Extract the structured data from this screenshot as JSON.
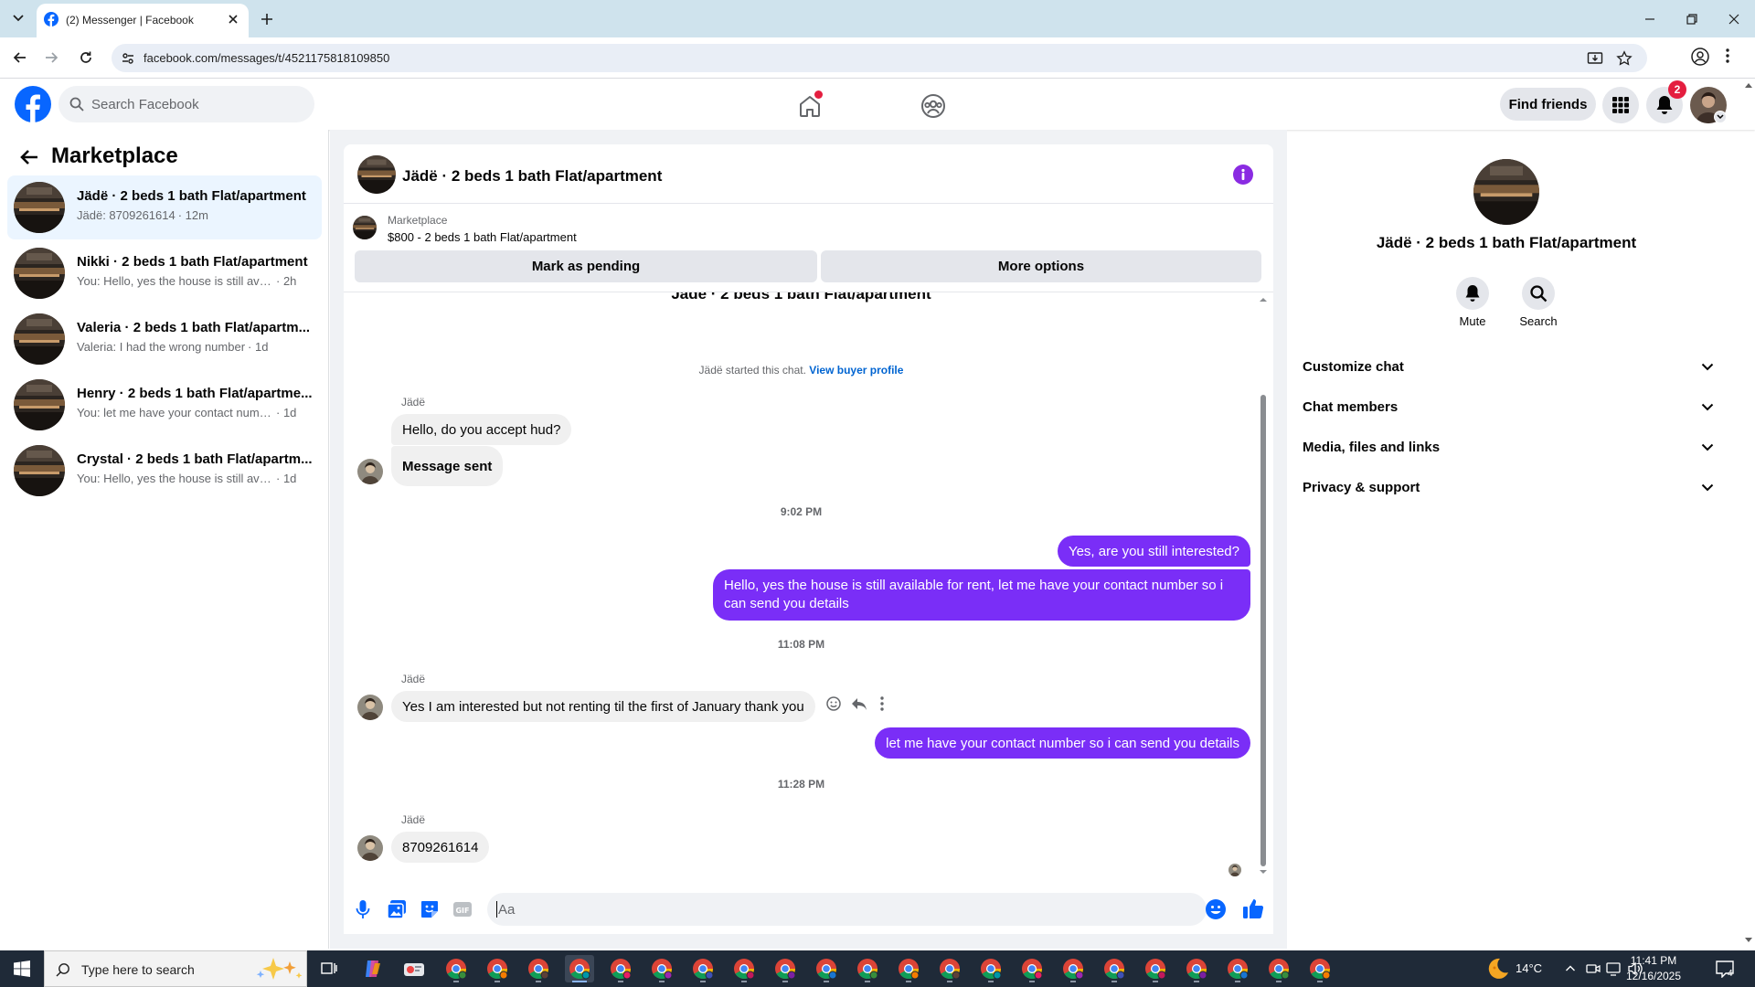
{
  "browser": {
    "tab_title": "(2) Messenger | Facebook",
    "url": "facebook.com/messages/t/4521175818109850"
  },
  "header": {
    "search_placeholder": "Search Facebook",
    "find_friends": "Find friends",
    "notification_count": "2"
  },
  "sidebar": {
    "title": "Marketplace",
    "conversations": [
      {
        "name": "Jädë · 2 beds 1 bath Flat/apartment",
        "preview": "Jädë: 8709261614",
        "time": " · 12m",
        "selected": true
      },
      {
        "name": "Nikki · 2 beds 1 bath Flat/apartment",
        "preview": "You: Hello, yes the house is still availa...",
        "time": " · 2h"
      },
      {
        "name": "Valeria · 2 beds 1 bath Flat/apartm...",
        "preview": "Valeria: I had the wrong number",
        "time": " · 1d"
      },
      {
        "name": "Henry · 2 beds 1 bath Flat/apartme...",
        "preview": "You: let me have your contact number...",
        "time": " · 1d"
      },
      {
        "name": "Crystal · 2 beds 1 bath Flat/apartm...",
        "preview": "You: Hello, yes the house is still availa...",
        "time": " · 1d"
      }
    ]
  },
  "chat": {
    "title": "Jädë · 2 beds 1 bath Flat/apartment",
    "listing_label": "Marketplace",
    "listing_price": "$800 - 2 beds 1 bath Flat/apartment",
    "mark_pending": "Mark as pending",
    "more_options": "More options",
    "partial_title": "Jädë · 2 beds 1 bath Flat/apartment",
    "started_text": "Jädë started this chat.",
    "view_profile": "View buyer profile",
    "sender_name": "Jädë",
    "messages": {
      "m1": "Hello, do you accept hud?",
      "m2": "Message sent",
      "ts1": "9:02 PM",
      "o1": "Yes, are you still interested?",
      "o2": "Hello, yes the house is still available for rent, let me have your contact number so i can send you details",
      "ts2": "11:08 PM",
      "m3": "Yes I am interested but not renting til the first of January thank you",
      "o3": "let me have your contact number so i can send you details",
      "ts3": "11:28 PM",
      "m4": "8709261614"
    },
    "input_placeholder": "Aa"
  },
  "details": {
    "name": "Jädë · 2 beds 1 bath Flat/apartment",
    "mute": "Mute",
    "search": "Search",
    "sections": [
      "Customize chat",
      "Chat members",
      "Media, files and links",
      "Privacy & support"
    ]
  },
  "taskbar": {
    "search_placeholder": "Type here to search",
    "temperature": "14°C",
    "time": "11:41 PM",
    "date": "12/16/2025",
    "notification_count": "4"
  },
  "colors": {
    "facebook_blue": "#0866ff",
    "outgoing_bubble": "#7a2ef7",
    "badge_red": "#e41e3f"
  }
}
